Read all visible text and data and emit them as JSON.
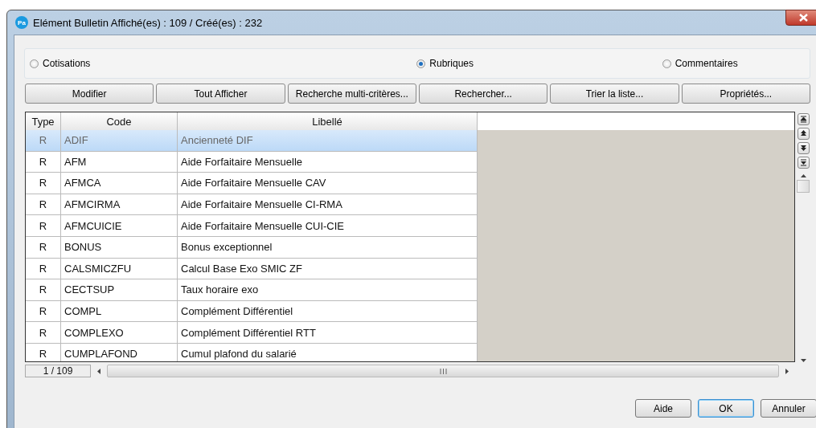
{
  "window": {
    "title": "Elément Bulletin Affiché(es) : 109 / Créé(es) : 232",
    "app_badge": "Pa"
  },
  "radios": [
    {
      "label": "Cotisations",
      "selected": false
    },
    {
      "label": "Rubriques",
      "selected": true
    },
    {
      "label": "Commentaires",
      "selected": false
    }
  ],
  "toolbar": [
    "Modifier",
    "Tout Afficher",
    "Recherche multi-critères...",
    "Rechercher...",
    "Trier la liste...",
    "Propriétés..."
  ],
  "table": {
    "columns": [
      "Type",
      "Code",
      "Libellé"
    ],
    "rows": [
      {
        "cells": [
          "R",
          "ADIF",
          "Ancienneté DIF"
        ],
        "selected": true
      },
      {
        "cells": [
          "R",
          "AFM",
          "Aide Forfaitaire Mensuelle"
        ],
        "selected": false
      },
      {
        "cells": [
          "R",
          "AFMCA",
          "Aide Forfaitaire Mensuelle CAV"
        ],
        "selected": false
      },
      {
        "cells": [
          "R",
          "AFMCIRMA",
          "Aide Forfaitaire Mensuelle CI-RMA"
        ],
        "selected": false
      },
      {
        "cells": [
          "R",
          "AFMCUICIE",
          "Aide Forfaitaire Mensuelle CUI-CIE"
        ],
        "selected": false
      },
      {
        "cells": [
          "R",
          "BONUS",
          "Bonus exceptionnel"
        ],
        "selected": false
      },
      {
        "cells": [
          "R",
          "CALSMICZFU",
          "Calcul Base Exo SMIC ZF"
        ],
        "selected": false
      },
      {
        "cells": [
          "R",
          "CECTSUP",
          "Taux horaire exo"
        ],
        "selected": false
      },
      {
        "cells": [
          "R",
          "COMPL",
          "Complément Différentiel"
        ],
        "selected": false
      },
      {
        "cells": [
          "R",
          "COMPLEXO",
          "Complément Différentiel RTT"
        ],
        "selected": false
      },
      {
        "cells": [
          "R",
          "CUMPLAFOND",
          "Cumul plafond du salarié"
        ],
        "selected": false
      }
    ],
    "counter": "1 / 109"
  },
  "buttons": [
    {
      "label": "Aide",
      "default": false
    },
    {
      "label": "OK",
      "default": true
    },
    {
      "label": "Annuler",
      "default": false
    }
  ]
}
